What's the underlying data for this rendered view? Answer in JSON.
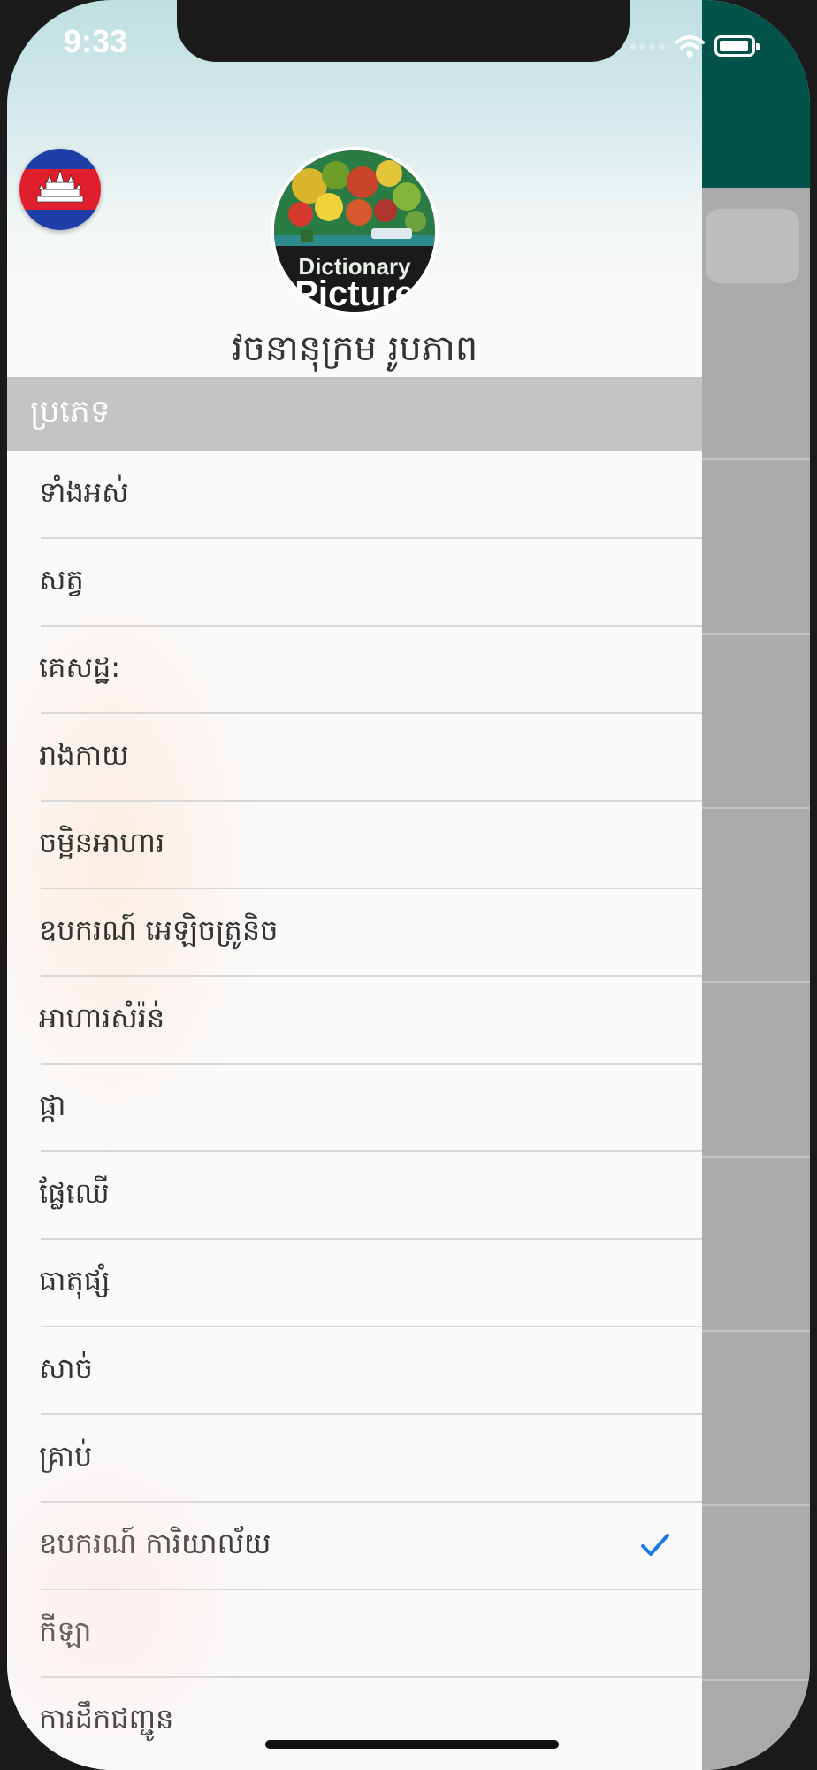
{
  "status_bar": {
    "time": "9:33"
  },
  "drawer": {
    "app_title": "វចនានុក្រម រូបភាព",
    "logo": {
      "line1": "Dictionary",
      "line2": "Picture"
    },
    "section_header": "ប្រភេទ",
    "items": [
      {
        "label": "ទាំងអស់",
        "checked": false
      },
      {
        "label": "សត្វ",
        "checked": false
      },
      {
        "label": "គេសដ្ឋ:",
        "checked": false
      },
      {
        "label": "រាងកាយ",
        "checked": false
      },
      {
        "label": "ចម្អិនអាហារ",
        "checked": false
      },
      {
        "label": "ឧបករណ៍ អេឡិចត្រូនិច",
        "checked": false
      },
      {
        "label": "អាហារសំរ៉ន់",
        "checked": false
      },
      {
        "label": "ផ្កា",
        "checked": false
      },
      {
        "label": "ផ្លែឈើ",
        "checked": false
      },
      {
        "label": "ធាតុផ្សំ",
        "checked": false
      },
      {
        "label": "សាច់",
        "checked": false
      },
      {
        "label": "គ្រាប់",
        "checked": false
      },
      {
        "label": "ឧបករណ៍ ការិយាល័យ",
        "checked": true
      },
      {
        "label": "កីឡា",
        "checked": false
      },
      {
        "label": "ការដឹកជញ្ជូន",
        "checked": false
      }
    ]
  },
  "colors": {
    "navbar": "#03534a",
    "check": "#1a7ae3",
    "section_header_bg": "#c4c4c4"
  },
  "icons": {
    "flag": "cambodia-flag-icon",
    "check": "checkmark-icon",
    "wifi": "wifi-icon",
    "battery": "battery-icon"
  }
}
